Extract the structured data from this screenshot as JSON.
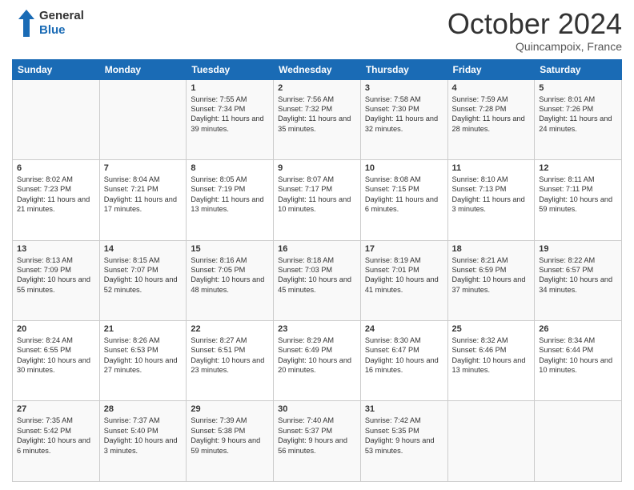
{
  "header": {
    "logo_line1": "General",
    "logo_line2": "Blue",
    "month": "October 2024",
    "location": "Quincampoix, France"
  },
  "weekdays": [
    "Sunday",
    "Monday",
    "Tuesday",
    "Wednesday",
    "Thursday",
    "Friday",
    "Saturday"
  ],
  "weeks": [
    [
      {
        "day": "",
        "sunrise": "",
        "sunset": "",
        "daylight": ""
      },
      {
        "day": "",
        "sunrise": "",
        "sunset": "",
        "daylight": ""
      },
      {
        "day": "1",
        "sunrise": "Sunrise: 7:55 AM",
        "sunset": "Sunset: 7:34 PM",
        "daylight": "Daylight: 11 hours and 39 minutes."
      },
      {
        "day": "2",
        "sunrise": "Sunrise: 7:56 AM",
        "sunset": "Sunset: 7:32 PM",
        "daylight": "Daylight: 11 hours and 35 minutes."
      },
      {
        "day": "3",
        "sunrise": "Sunrise: 7:58 AM",
        "sunset": "Sunset: 7:30 PM",
        "daylight": "Daylight: 11 hours and 32 minutes."
      },
      {
        "day": "4",
        "sunrise": "Sunrise: 7:59 AM",
        "sunset": "Sunset: 7:28 PM",
        "daylight": "Daylight: 11 hours and 28 minutes."
      },
      {
        "day": "5",
        "sunrise": "Sunrise: 8:01 AM",
        "sunset": "Sunset: 7:26 PM",
        "daylight": "Daylight: 11 hours and 24 minutes."
      }
    ],
    [
      {
        "day": "6",
        "sunrise": "Sunrise: 8:02 AM",
        "sunset": "Sunset: 7:23 PM",
        "daylight": "Daylight: 11 hours and 21 minutes."
      },
      {
        "day": "7",
        "sunrise": "Sunrise: 8:04 AM",
        "sunset": "Sunset: 7:21 PM",
        "daylight": "Daylight: 11 hours and 17 minutes."
      },
      {
        "day": "8",
        "sunrise": "Sunrise: 8:05 AM",
        "sunset": "Sunset: 7:19 PM",
        "daylight": "Daylight: 11 hours and 13 minutes."
      },
      {
        "day": "9",
        "sunrise": "Sunrise: 8:07 AM",
        "sunset": "Sunset: 7:17 PM",
        "daylight": "Daylight: 11 hours and 10 minutes."
      },
      {
        "day": "10",
        "sunrise": "Sunrise: 8:08 AM",
        "sunset": "Sunset: 7:15 PM",
        "daylight": "Daylight: 11 hours and 6 minutes."
      },
      {
        "day": "11",
        "sunrise": "Sunrise: 8:10 AM",
        "sunset": "Sunset: 7:13 PM",
        "daylight": "Daylight: 11 hours and 3 minutes."
      },
      {
        "day": "12",
        "sunrise": "Sunrise: 8:11 AM",
        "sunset": "Sunset: 7:11 PM",
        "daylight": "Daylight: 10 hours and 59 minutes."
      }
    ],
    [
      {
        "day": "13",
        "sunrise": "Sunrise: 8:13 AM",
        "sunset": "Sunset: 7:09 PM",
        "daylight": "Daylight: 10 hours and 55 minutes."
      },
      {
        "day": "14",
        "sunrise": "Sunrise: 8:15 AM",
        "sunset": "Sunset: 7:07 PM",
        "daylight": "Daylight: 10 hours and 52 minutes."
      },
      {
        "day": "15",
        "sunrise": "Sunrise: 8:16 AM",
        "sunset": "Sunset: 7:05 PM",
        "daylight": "Daylight: 10 hours and 48 minutes."
      },
      {
        "day": "16",
        "sunrise": "Sunrise: 8:18 AM",
        "sunset": "Sunset: 7:03 PM",
        "daylight": "Daylight: 10 hours and 45 minutes."
      },
      {
        "day": "17",
        "sunrise": "Sunrise: 8:19 AM",
        "sunset": "Sunset: 7:01 PM",
        "daylight": "Daylight: 10 hours and 41 minutes."
      },
      {
        "day": "18",
        "sunrise": "Sunrise: 8:21 AM",
        "sunset": "Sunset: 6:59 PM",
        "daylight": "Daylight: 10 hours and 37 minutes."
      },
      {
        "day": "19",
        "sunrise": "Sunrise: 8:22 AM",
        "sunset": "Sunset: 6:57 PM",
        "daylight": "Daylight: 10 hours and 34 minutes."
      }
    ],
    [
      {
        "day": "20",
        "sunrise": "Sunrise: 8:24 AM",
        "sunset": "Sunset: 6:55 PM",
        "daylight": "Daylight: 10 hours and 30 minutes."
      },
      {
        "day": "21",
        "sunrise": "Sunrise: 8:26 AM",
        "sunset": "Sunset: 6:53 PM",
        "daylight": "Daylight: 10 hours and 27 minutes."
      },
      {
        "day": "22",
        "sunrise": "Sunrise: 8:27 AM",
        "sunset": "Sunset: 6:51 PM",
        "daylight": "Daylight: 10 hours and 23 minutes."
      },
      {
        "day": "23",
        "sunrise": "Sunrise: 8:29 AM",
        "sunset": "Sunset: 6:49 PM",
        "daylight": "Daylight: 10 hours and 20 minutes."
      },
      {
        "day": "24",
        "sunrise": "Sunrise: 8:30 AM",
        "sunset": "Sunset: 6:47 PM",
        "daylight": "Daylight: 10 hours and 16 minutes."
      },
      {
        "day": "25",
        "sunrise": "Sunrise: 8:32 AM",
        "sunset": "Sunset: 6:46 PM",
        "daylight": "Daylight: 10 hours and 13 minutes."
      },
      {
        "day": "26",
        "sunrise": "Sunrise: 8:34 AM",
        "sunset": "Sunset: 6:44 PM",
        "daylight": "Daylight: 10 hours and 10 minutes."
      }
    ],
    [
      {
        "day": "27",
        "sunrise": "Sunrise: 7:35 AM",
        "sunset": "Sunset: 5:42 PM",
        "daylight": "Daylight: 10 hours and 6 minutes."
      },
      {
        "day": "28",
        "sunrise": "Sunrise: 7:37 AM",
        "sunset": "Sunset: 5:40 PM",
        "daylight": "Daylight: 10 hours and 3 minutes."
      },
      {
        "day": "29",
        "sunrise": "Sunrise: 7:39 AM",
        "sunset": "Sunset: 5:38 PM",
        "daylight": "Daylight: 9 hours and 59 minutes."
      },
      {
        "day": "30",
        "sunrise": "Sunrise: 7:40 AM",
        "sunset": "Sunset: 5:37 PM",
        "daylight": "Daylight: 9 hours and 56 minutes."
      },
      {
        "day": "31",
        "sunrise": "Sunrise: 7:42 AM",
        "sunset": "Sunset: 5:35 PM",
        "daylight": "Daylight: 9 hours and 53 minutes."
      },
      {
        "day": "",
        "sunrise": "",
        "sunset": "",
        "daylight": ""
      },
      {
        "day": "",
        "sunrise": "",
        "sunset": "",
        "daylight": ""
      }
    ]
  ]
}
